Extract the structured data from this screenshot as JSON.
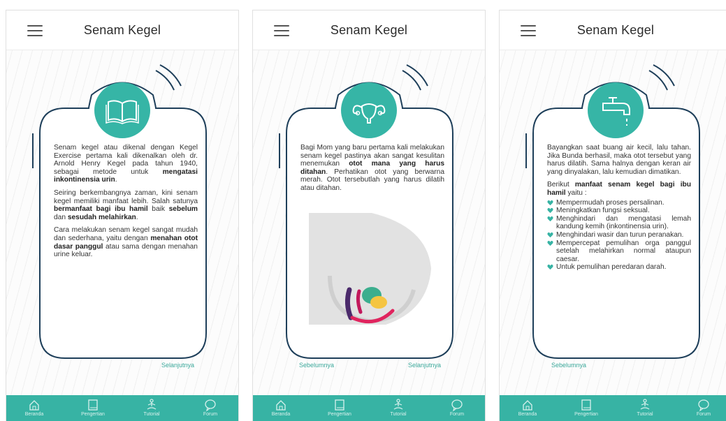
{
  "accent_color": "#37b3a4",
  "frame_color": "#1e3f5a",
  "screens": [
    {
      "title": "Senam Kegel",
      "icon": "book-icon",
      "paragraphs": [
        [
          "Senam kegel atau dikenal dengan Kegel Exercise pertama kali dikenalkan oleh dr. Arnold Henry Kegel pada tahun 1940, sebagai metode untuk ",
          "mengatasi inkontinensia urin",
          "."
        ],
        [
          "Seiring berkembangnya zaman, kini senam kegel memiliki manfaat lebih. Salah satunya ",
          "bermanfaat bagi ibu hamil",
          " baik ",
          "sebelum",
          " dan ",
          "sesudah melahirkan",
          "."
        ],
        [
          "Cara melakukan senam kegel sangat mudah dan sederhana, yaitu dengan ",
          "menahan otot dasar panggul",
          " atau sama dengan menahan urine keluar."
        ]
      ],
      "next_label": "Selanjutnya"
    },
    {
      "title": "Senam Kegel",
      "icon": "uterus-icon",
      "paragraphs": [
        [
          "Bagi Mom yang baru pertama kali melakukan senam kegel pastinya akan sangat kesulitan menemukan ",
          "otot mana yang harus ditahan",
          ". Perhatikan otot yang berwarna merah. Otot tersebutlah yang harus dilatih atau ditahan."
        ]
      ],
      "prev_label": "Sebelumnya",
      "next_label": "Selanjutnya"
    },
    {
      "title": "Senam Kegel",
      "icon": "faucet-icon",
      "paragraphs": [
        [
          "Bayangkan saat buang air kecil, lalu tahan. Jika Bunda berhasil, maka otot tersebut yang harus dilatih. Sama halnya dengan keran air yang dinyalakan, lalu kemudian dimatikan."
        ],
        [
          "Berikut ",
          "manfaat senam kegel bagi ibu hamil",
          " yaitu :"
        ]
      ],
      "benefits": [
        "Mempermudah proses persalinan.",
        "Meningkatkan fungsi seksual.",
        "Menghindari dan mengatasi lemah kandung kemih (inkontinensia urin).",
        "Menghindari wasir dan turun peranakan.",
        "Mempercepat pemulihan orga panggul setelah melahirkan normal ataupun caesar.",
        "Untuk pemulihan peredaran darah."
      ],
      "prev_label": "Sebelumnya"
    }
  ],
  "tabs": [
    {
      "label": "Beranda",
      "icon": "home-icon"
    },
    {
      "label": "Pengertian",
      "icon": "book-icon"
    },
    {
      "label": "Tutorial",
      "icon": "meditation-icon"
    },
    {
      "label": "Forum",
      "icon": "chat-bubble-icon"
    }
  ]
}
